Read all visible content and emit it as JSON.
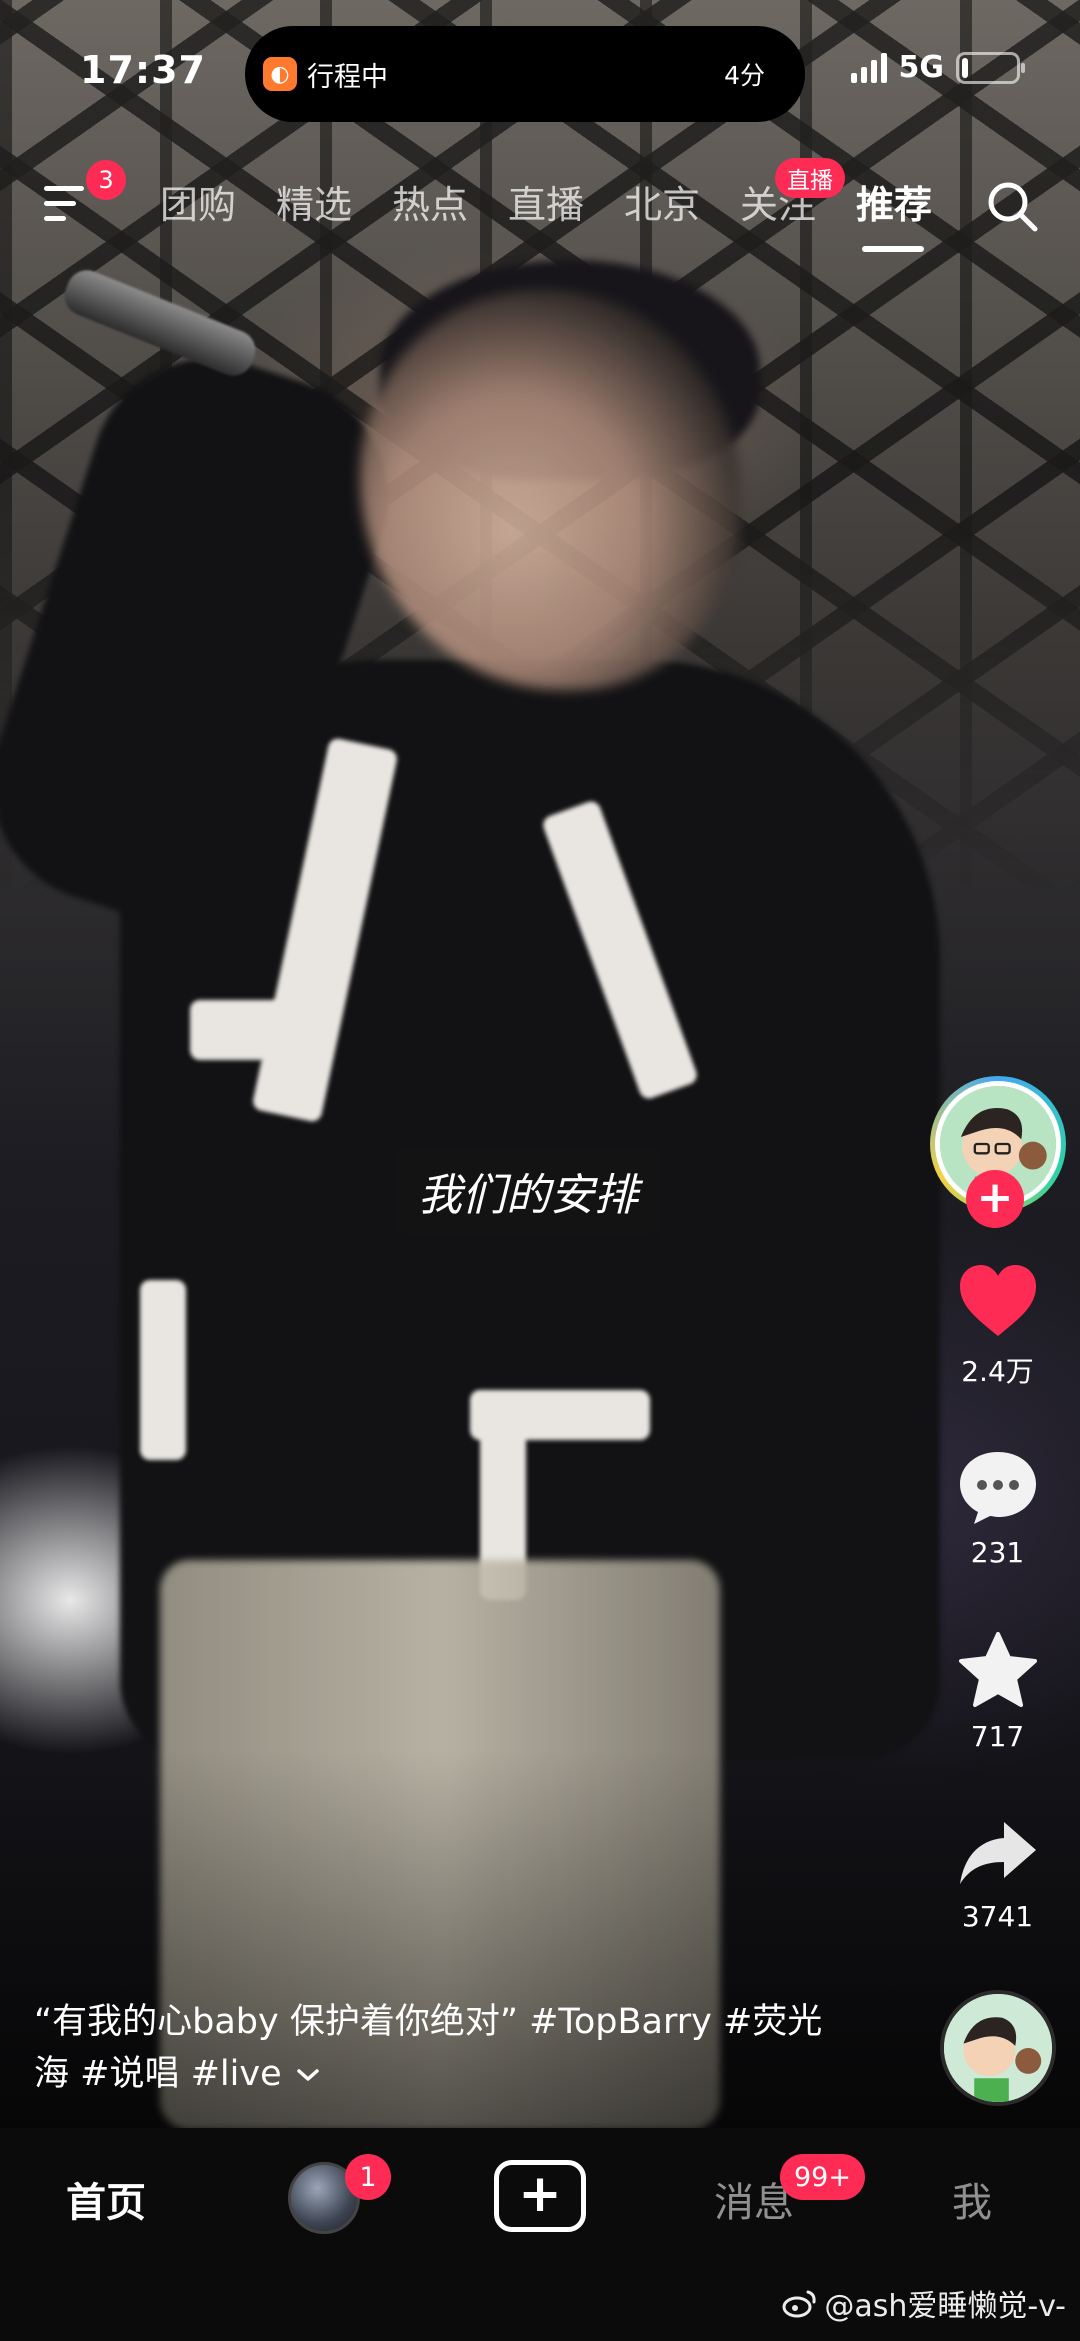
{
  "status_bar": {
    "time": "17:37",
    "island_label": "行程中",
    "island_eta": "4分",
    "network": "5G",
    "battery_level": 0.12
  },
  "top_tabs": {
    "menu_badge": "3",
    "tabs": [
      "团购",
      "精选",
      "热点",
      "直播",
      "北京",
      "关注",
      "推荐"
    ],
    "active_index": 6,
    "live_badge": "直播"
  },
  "video": {
    "subtitle": "我们的安排",
    "caption_line1": "“有我的心baby 保护着你绝对” #TopBarry #荧光",
    "caption_line2": "海 #说唱 #live"
  },
  "actions": {
    "likes": "2.4万",
    "comments": "231",
    "favorites": "717",
    "shares": "3741"
  },
  "bottom_nav": {
    "home": "首页",
    "friend_badge": "1",
    "messages": "消息",
    "messages_badge": "99+",
    "me": "我"
  },
  "watermark": "@ash爱睡懒觉-v-",
  "colors": {
    "accent": "#fe2c55",
    "nav_bg": "#0b0b0b"
  }
}
